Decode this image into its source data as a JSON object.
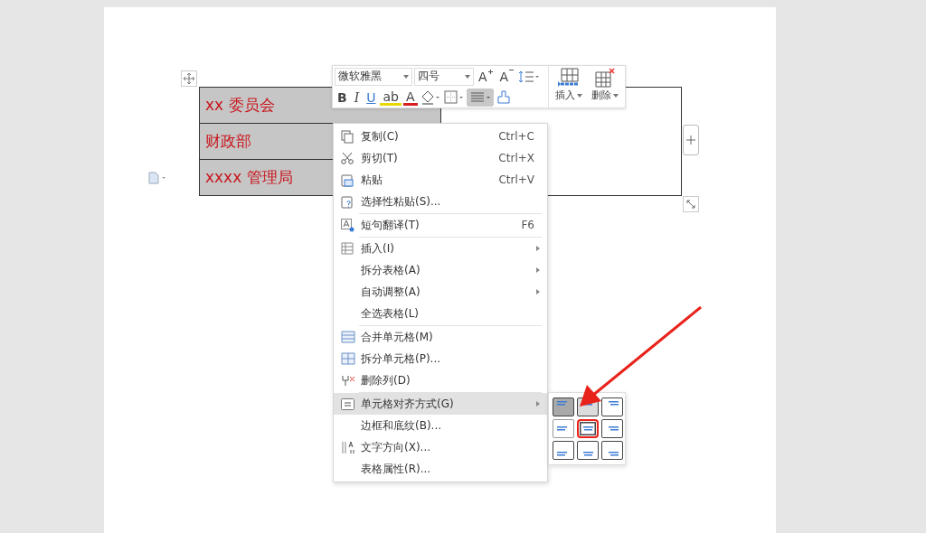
{
  "table": {
    "rows": [
      {
        "text": "xx 委员会"
      },
      {
        "text": "财政部"
      },
      {
        "text": "xxxx 管理局"
      }
    ]
  },
  "toolbar": {
    "font_name": "微软雅黑",
    "font_size": "四号",
    "top_buttons": [
      {
        "kind": "grow",
        "label": "A"
      },
      {
        "kind": "shrink",
        "label": "A"
      },
      {
        "kind": "spacing"
      }
    ],
    "bottom_buttons": [
      {
        "kind": "bold",
        "label": "B",
        "selected": false
      },
      {
        "kind": "italic",
        "label": "I",
        "selected": false
      },
      {
        "kind": "underline",
        "label": "U",
        "selected": false
      },
      {
        "kind": "highlight",
        "label": "ab",
        "selected": false
      },
      {
        "kind": "font-color",
        "label": "A",
        "selected": false
      },
      {
        "kind": "fill",
        "selected": false
      },
      {
        "kind": "border",
        "selected": false
      },
      {
        "kind": "align",
        "selected": true
      },
      {
        "kind": "painter",
        "selected": false
      }
    ],
    "big_buttons": [
      {
        "kind": "insert",
        "label": "插入"
      },
      {
        "kind": "delete",
        "label": "删除"
      }
    ]
  },
  "context_menu": [
    {
      "kind": "copy",
      "label": "复制(C)",
      "shortcut": "Ctrl+C",
      "submenu": false,
      "selected": false,
      "separator_after": false
    },
    {
      "kind": "cut",
      "label": "剪切(T)",
      "shortcut": "Ctrl+X",
      "submenu": false,
      "selected": false,
      "separator_after": false
    },
    {
      "kind": "paste",
      "label": "粘贴",
      "shortcut": "Ctrl+V",
      "submenu": false,
      "selected": false,
      "separator_after": false
    },
    {
      "kind": "paste-special",
      "label": "选择性粘贴(S)...",
      "submenu": false,
      "selected": false,
      "separator_after": true
    },
    {
      "kind": "translate",
      "label": "短句翻译(T)",
      "shortcut": "F6",
      "submenu": false,
      "selected": false,
      "separator_after": true
    },
    {
      "kind": "table",
      "label": "插入(I)",
      "submenu": true,
      "selected": false,
      "separator_after": false
    },
    {
      "label": "拆分表格(A)",
      "submenu": true,
      "selected": false,
      "separator_after": false
    },
    {
      "label": "自动调整(A)",
      "submenu": true,
      "selected": false,
      "separator_after": false
    },
    {
      "label": "全选表格(L)",
      "submenu": false,
      "selected": false,
      "separator_after": true
    },
    {
      "kind": "merge",
      "label": "合并单元格(M)",
      "submenu": false,
      "selected": false,
      "separator_after": false
    },
    {
      "kind": "split",
      "label": "拆分单元格(P)...",
      "submenu": false,
      "selected": false,
      "separator_after": false
    },
    {
      "kind": "delete-col",
      "label": "删除列(D)",
      "submenu": false,
      "selected": false,
      "separator_after": true
    },
    {
      "kind": "align",
      "label": "单元格对齐方式(G)",
      "submenu": true,
      "selected": true,
      "separator_after": false
    },
    {
      "label": "边框和底纹(B)...",
      "submenu": false,
      "selected": false,
      "separator_after": false
    },
    {
      "kind": "direction",
      "label": "文字方向(X)...",
      "submenu": false,
      "selected": false,
      "separator_after": false
    },
    {
      "label": "表格属性(R)...",
      "submenu": false,
      "selected": false,
      "separator_after": false
    }
  ],
  "alignment_grid": [
    {
      "kind": "top-left",
      "selected": true,
      "hovered": false,
      "highlighted": false
    },
    {
      "kind": "top-center",
      "selected": false,
      "hovered": true,
      "highlighted": false
    },
    {
      "kind": "top-right",
      "selected": false,
      "hovered": false,
      "highlighted": false
    },
    {
      "kind": "middle-left",
      "selected": false,
      "hovered": false,
      "highlighted": false
    },
    {
      "kind": "middle-center",
      "selected": false,
      "hovered": false,
      "highlighted": true
    },
    {
      "kind": "middle-right",
      "selected": false,
      "hovered": false,
      "highlighted": false
    },
    {
      "kind": "bottom-left",
      "selected": false,
      "hovered": false,
      "highlighted": false
    },
    {
      "kind": "bottom-center",
      "selected": false,
      "hovered": false,
      "highlighted": false
    },
    {
      "kind": "bottom-right",
      "selected": false,
      "hovered": false,
      "highlighted": false
    }
  ]
}
